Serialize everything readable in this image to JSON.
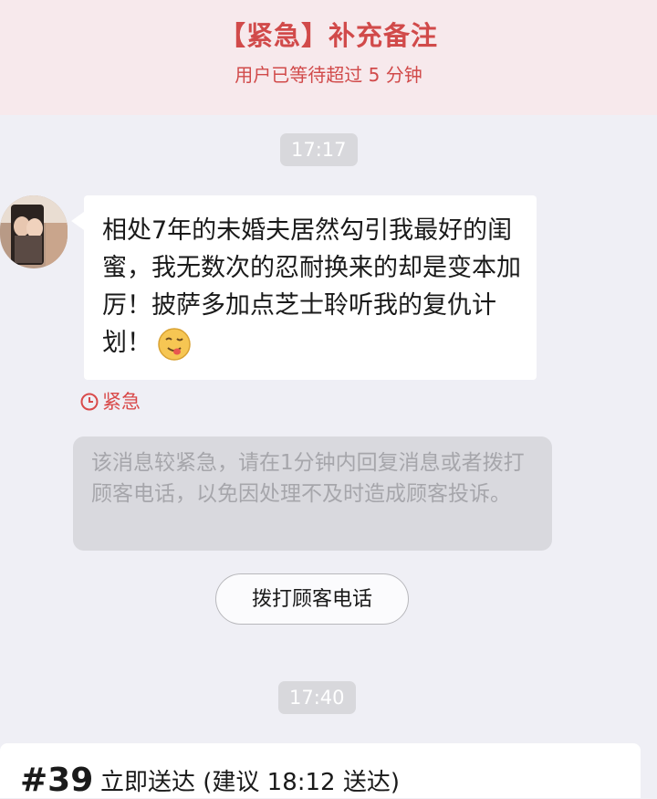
{
  "header": {
    "title": "【紧急】补充备注",
    "subtitle": "用户已等待超过 5 分钟"
  },
  "chat": {
    "time_1": "17:17",
    "message": "相处7年的未婚夫居然勾引我最好的闺蜜，我无数次的忍耐换来的却是变本加厉！披萨多加点芝士聆听我的复仇计划！",
    "emoji_icon": "tongue-out-emoji-icon",
    "urgent_label": "紧急",
    "notice": "该消息较紧急，请在1分钟内回复消息或者拨打顾客电话，以免因处理不及时造成顾客投诉。",
    "call_button": "拨打顾客电话",
    "time_2": "17:40"
  },
  "order": {
    "number": "#39",
    "delivery": "立即送达 (建议 18:12 送达)"
  },
  "colors": {
    "accent_red": "#d14a4a",
    "header_bg": "#f7e9ec",
    "page_bg": "#efeff5"
  }
}
